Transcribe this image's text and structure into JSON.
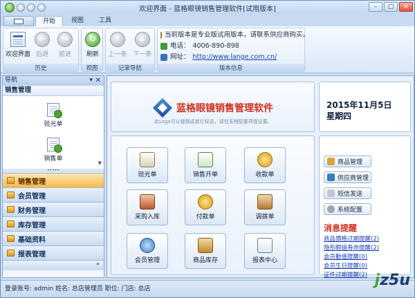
{
  "window": {
    "title": "欢迎界面 - 蓝格眼镜销售管理软件[试用版本]"
  },
  "tabs": [
    "开始",
    "视图",
    "工具"
  ],
  "ribbon": {
    "history": {
      "label": "历史",
      "buttons": [
        "欢迎界面",
        "后退",
        "前进"
      ]
    },
    "view": {
      "label": "视图",
      "buttons": [
        "刷新"
      ]
    },
    "record": {
      "label": "记录导航",
      "buttons": [
        "上一条",
        "下一条"
      ]
    },
    "version": {
      "label": "版本信息",
      "notice": "当前版本是专业版试用版本，请联系供应商购买。",
      "phone_label": "电话：",
      "phone": "4006-890-898",
      "site_label": "网址：",
      "site": "http://www.lange.com.cn/"
    }
  },
  "sidebar": {
    "title": "导航",
    "pin": "▾",
    "close": "✕",
    "section": "销售管理",
    "items": [
      "验光单",
      "销售单"
    ],
    "nav": [
      "销售管理",
      "会员管理",
      "财务管理",
      "库存管理",
      "基础资料",
      "报表管理"
    ]
  },
  "logo": {
    "name": "蓝格眼镜销售管理软件",
    "note": "此Logo可以替换成其它标志，请在系统配置界面设置。"
  },
  "date": {
    "day": "2015年11月5日",
    "weekday": "星期四"
  },
  "tiles": [
    "验光单",
    "销售开单",
    "收款单",
    "采购入库",
    "付款单",
    "调拨单",
    "会员管理",
    "商品库存",
    "报表中心"
  ],
  "quick": [
    "商品管理",
    "供应商管理",
    "短信发送",
    "系统配置"
  ],
  "messages": {
    "title": "消息提醒",
    "items": [
      "商品價格过期提醒(2)",
      "隐形眼镜寿命提醒(2)",
      "会员勤值提醒(0)",
      "会员生日提醒(0)",
      "证件过期提醒(2)"
    ]
  },
  "status": {
    "text": "登录账号: admin  姓名: 总店管理员  职位:   门店: 总店"
  },
  "watermark": {
    "a": "j",
    "b": "z5u"
  },
  "colors": {
    "accent": "#d0301d",
    "link": "#1a3fb0",
    "active_nav": "#f6b94c"
  }
}
